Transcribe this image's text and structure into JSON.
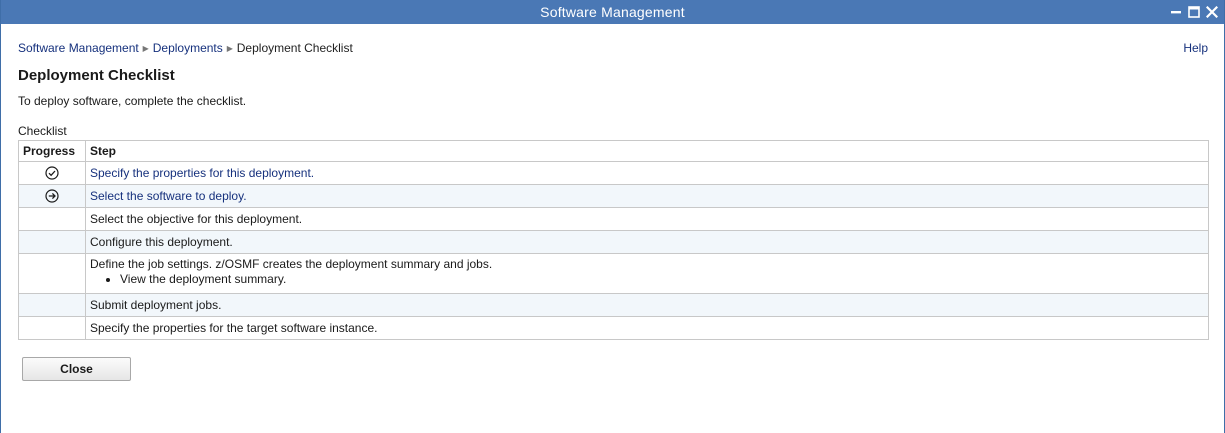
{
  "window": {
    "title": "Software Management",
    "controls": [
      "minimize-icon",
      "maximize-icon",
      "close-icon"
    ]
  },
  "breadcrumb": {
    "items": [
      "Software Management",
      "Deployments"
    ],
    "current": "Deployment Checklist"
  },
  "help_label": "Help",
  "page_title": "Deployment Checklist",
  "intro": "To deploy software, complete the checklist.",
  "checklist": {
    "caption": "Checklist",
    "columns": [
      "Progress",
      "Step"
    ],
    "rows": [
      {
        "status": "completed",
        "status_icon": "check-circle-icon",
        "step": "Specify the properties for this deployment."
      },
      {
        "status": "current",
        "status_icon": "arrow-circle-icon",
        "step": "Select the software to deploy."
      },
      {
        "status": "",
        "step": "Select the objective for this deployment."
      },
      {
        "status": "",
        "step": "Configure this deployment."
      },
      {
        "status": "",
        "step": "Define the job settings. z/OSMF creates the deployment summary and jobs.",
        "substeps": [
          "View the deployment summary."
        ]
      },
      {
        "status": "",
        "step": "Submit deployment jobs."
      },
      {
        "status": "",
        "step": "Specify the properties for the target software instance."
      }
    ]
  },
  "close_label": "Close",
  "colors": {
    "titlebar": "#4a78b5",
    "link": "#16317d",
    "alt_row": "#f2f7fb",
    "border": "#c8c8c8"
  }
}
